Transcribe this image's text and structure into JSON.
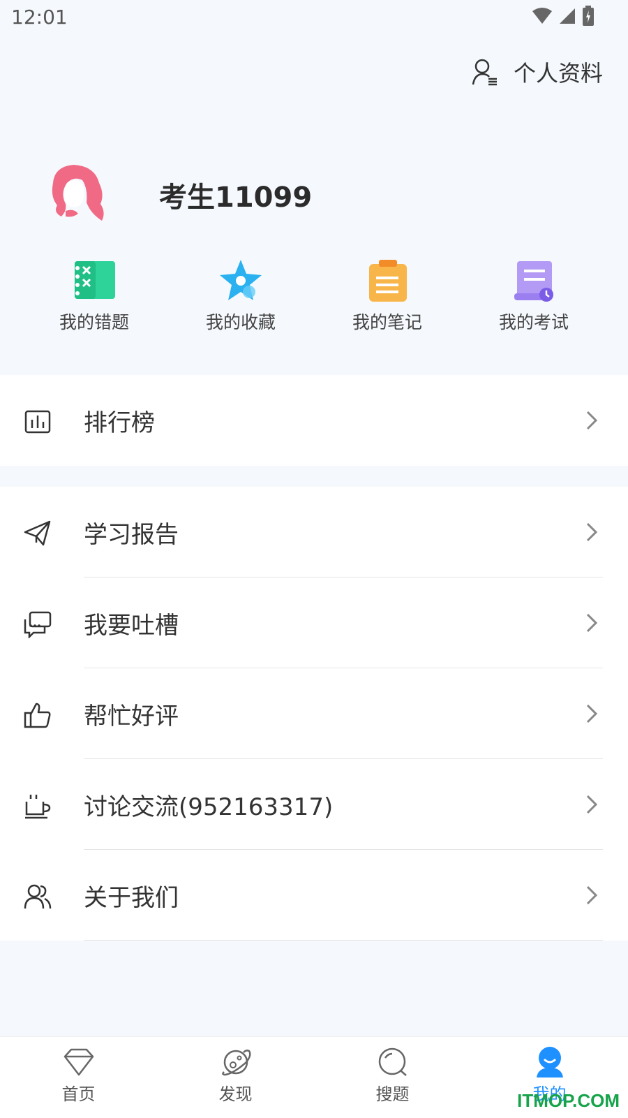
{
  "status": {
    "time": "12:01"
  },
  "header": {
    "profile_label": "个人资料"
  },
  "user": {
    "name": "考生11099"
  },
  "quick_actions": [
    {
      "label": "我的错题",
      "icon": "wrong-questions-icon",
      "color": "#22c98a"
    },
    {
      "label": "我的收藏",
      "icon": "star-icon",
      "color": "#2bb1f0"
    },
    {
      "label": "我的笔记",
      "icon": "clipboard-icon",
      "color": "#f8b54a"
    },
    {
      "label": "我的考试",
      "icon": "exam-scroll-icon",
      "color": "#9b7ff0"
    }
  ],
  "menu_ranking": {
    "label": "排行榜",
    "icon": "bar-chart-icon"
  },
  "menu": [
    {
      "label": "学习报告",
      "icon": "paper-plane-icon"
    },
    {
      "label": "我要吐槽",
      "icon": "chat-bubbles-icon"
    },
    {
      "label": "帮忙好评",
      "icon": "thumbs-up-icon"
    },
    {
      "label": "讨论交流(952163317)",
      "icon": "coffee-cup-icon"
    },
    {
      "label": "关于我们",
      "icon": "users-icon"
    }
  ],
  "tabs": [
    {
      "label": "首页",
      "icon": "diamond-icon"
    },
    {
      "label": "发现",
      "icon": "planet-icon"
    },
    {
      "label": "搜题",
      "icon": "search-icon"
    },
    {
      "label": "我的",
      "icon": "profile-icon",
      "active": true
    }
  ],
  "watermark": "ITMOP.COM",
  "accent": "#1e90ff"
}
